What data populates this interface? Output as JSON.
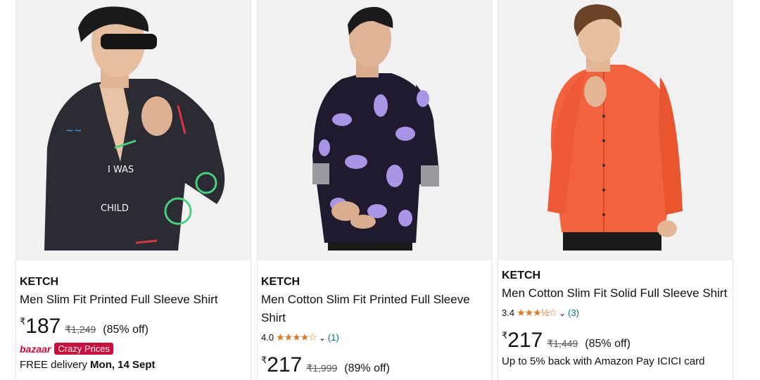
{
  "products": [
    {
      "brand": "KETCH",
      "title": "Men Slim Fit Printed Full Sleeve Shirt",
      "currency": "₹",
      "price": "187",
      "mrp": "₹1,249",
      "discount": "(85% off)",
      "bazaar_label": "bazaar",
      "deal_badge": "Crazy Prices",
      "delivery_prefix": "FREE delivery ",
      "delivery_date": "Mon, 14 Sept"
    },
    {
      "brand": "KETCH",
      "title": "Men Cotton Slim Fit Printed Full Sleeve Shirt",
      "rating": "4.0",
      "stars": "★★★★☆",
      "review_count": "(1)",
      "currency": "₹",
      "price": "217",
      "mrp": "₹1,999",
      "discount": "(89% off)"
    },
    {
      "brand": "KETCH",
      "title": "Men Cotton Slim Fit Solid Full Sleeve Shirt",
      "rating": "3.4",
      "stars": "★★★½☆",
      "review_count": "(3)",
      "currency": "₹",
      "price": "217",
      "mrp": "₹1,449",
      "discount": "(85% off)",
      "offer": "Up to 5% back with Amazon Pay ICICI card"
    }
  ],
  "colors": {
    "star": "#de7921",
    "link": "#007185",
    "deal": "#cc0c39",
    "shirt_1": "#2b2b33",
    "shirt_2": "#1f1a2e",
    "shirt_3": "#f2623d"
  }
}
